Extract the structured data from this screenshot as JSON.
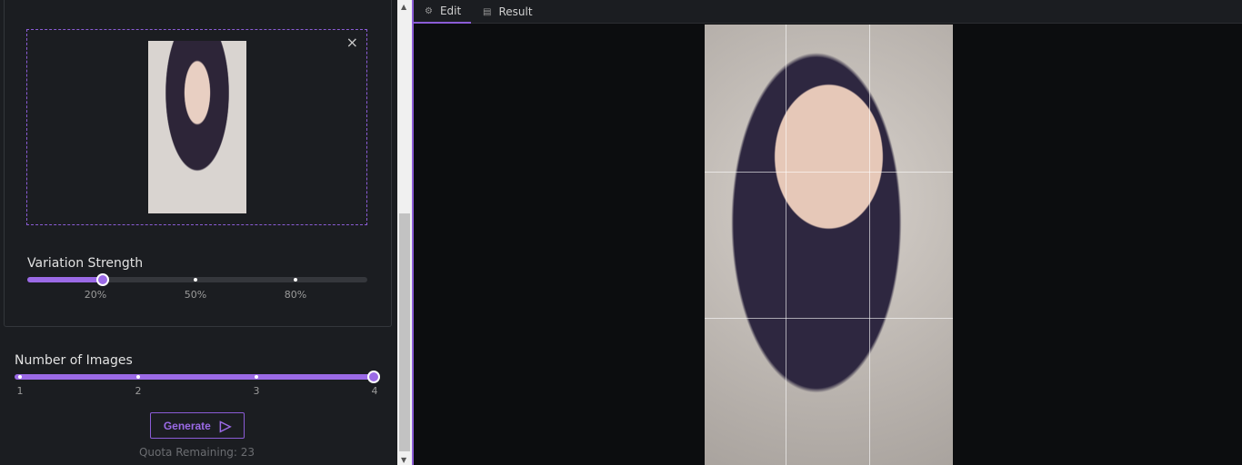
{
  "upload": {
    "close_icon": "×"
  },
  "variation": {
    "label": "Variation Strength",
    "value_percent": 20,
    "ticks": [
      "20%",
      "50%",
      "80%"
    ]
  },
  "images": {
    "label": "Number of Images",
    "value": 4,
    "ticks": [
      "1",
      "2",
      "3",
      "4"
    ]
  },
  "generate": {
    "label": "Generate",
    "icon": "▷"
  },
  "quota": "Quota Remaining: 23",
  "tabs": [
    {
      "label": "Edit",
      "icon": "⚙"
    },
    {
      "label": "Result",
      "icon": "▤"
    }
  ],
  "accent": "#9b6ae6"
}
